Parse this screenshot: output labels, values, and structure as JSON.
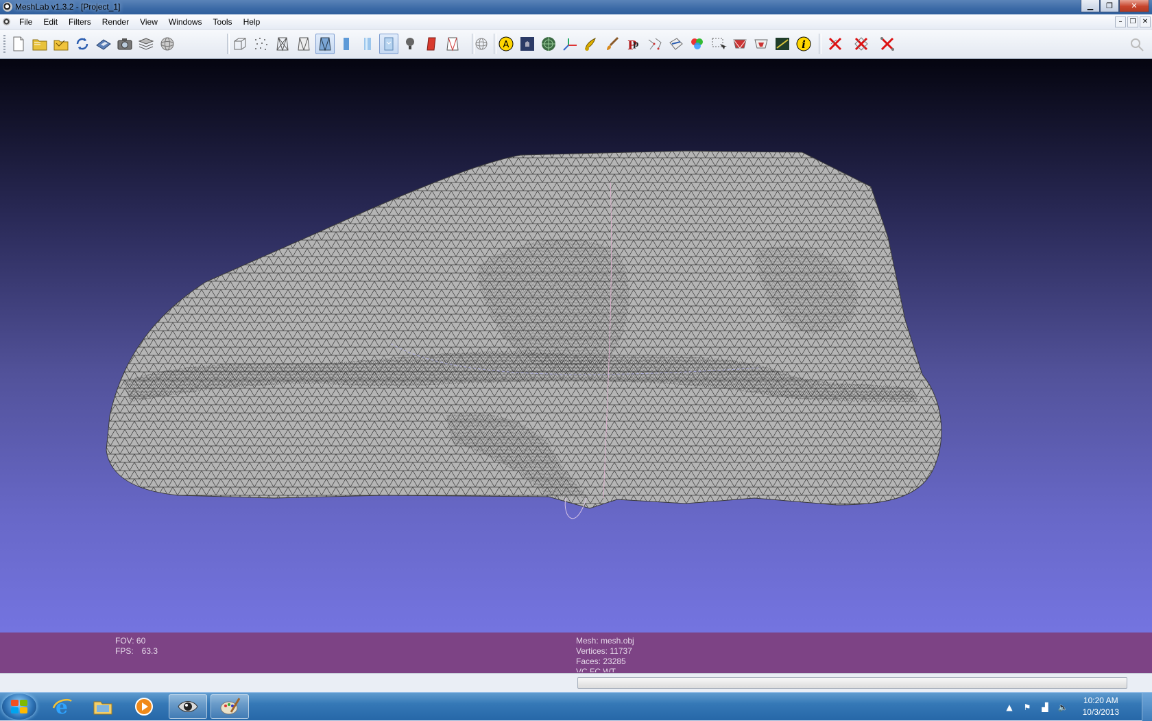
{
  "window": {
    "title": "MeshLab v1.3.2 - [Project_1]"
  },
  "menubar": {
    "items": [
      "File",
      "Edit",
      "Filters",
      "Render",
      "View",
      "Windows",
      "Tools",
      "Help"
    ]
  },
  "info": {
    "fov_label": "FOV:",
    "fov_value": "60",
    "fps_label": "FPS:",
    "fps_value": "63.3",
    "mesh": "Mesh: mesh.obj",
    "vertices": "Vertices: 11737",
    "faces": "Faces: 23285",
    "attributes": "VC FC WT"
  },
  "taskbar": {
    "clock_time": "10:20 AM",
    "clock_date": "10/3/2013"
  },
  "colors": {
    "accent_purple": "#7d4385",
    "viewport_top": "#050510",
    "viewport_bottom": "#7474e0",
    "mesh_fill": "#b4b4b4",
    "mesh_wire": "#3a3a3a"
  },
  "icons": [
    "new-project-icon",
    "open-project-icon",
    "import-mesh-icon",
    "reload-icon",
    "save-icon",
    "snapshot-icon",
    "layers-icon",
    "sphere-icon",
    "bbox-icon",
    "points-icon",
    "wireframe-icon",
    "hidden-lines-icon",
    "flat-lines-icon",
    "flat-icon",
    "smooth-icon",
    "texture-icon",
    "light-icon",
    "backface-icon",
    "selected-faces-icon",
    "trackball-icon",
    "annotation-icon",
    "raster-icon",
    "mesh-sphere-icon",
    "axis-icon",
    "paint-icon",
    "brush-icon",
    "pick-points-icon",
    "align-icon",
    "manipulator-icon",
    "color-icon",
    "select-vertices-icon",
    "select-faces-icon",
    "select-region-icon",
    "measure-icon",
    "info-icon",
    "delete-vertices-icon",
    "delete-faces-icon",
    "delete-all-icon",
    "search-icon"
  ]
}
